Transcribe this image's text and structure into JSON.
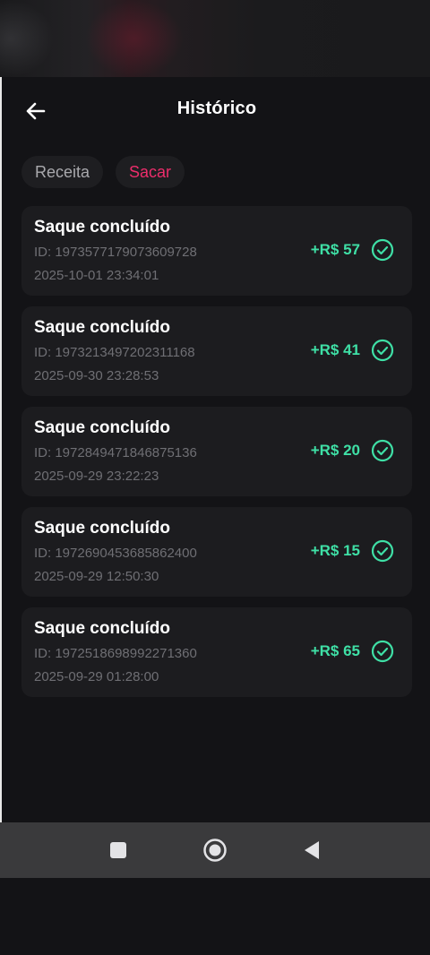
{
  "header": {
    "title": "Histórico",
    "back_icon": "arrow-left-icon"
  },
  "tabs": [
    {
      "label": "Receita",
      "active": false
    },
    {
      "label": "Sacar",
      "active": true
    }
  ],
  "transactions": [
    {
      "title": "Saque concluído",
      "id": "ID: 1973577179073609728",
      "date": "2025-10-01 23:34:01",
      "amount": "+R$ 57",
      "status_icon": "check-circle-icon"
    },
    {
      "title": "Saque concluído",
      "id": "ID: 1973213497202311168",
      "date": "2025-09-30 23:28:53",
      "amount": "+R$ 41",
      "status_icon": "check-circle-icon"
    },
    {
      "title": "Saque concluído",
      "id": "ID: 1972849471846875136",
      "date": "2025-09-29 23:22:23",
      "amount": "+R$ 20",
      "status_icon": "check-circle-icon"
    },
    {
      "title": "Saque concluído",
      "id": "ID: 1972690453685862400",
      "date": "2025-09-29 12:50:30",
      "amount": "+R$ 15",
      "status_icon": "check-circle-icon"
    },
    {
      "title": "Saque concluído",
      "id": "ID: 1972518698992271360",
      "date": "2025-09-29 01:28:00",
      "amount": "+R$ 65",
      "status_icon": "check-circle-icon"
    }
  ],
  "nav": {
    "recents_icon": "square-icon",
    "home_icon": "circle-home-icon",
    "back_icon": "triangle-back-icon"
  },
  "colors": {
    "accent": "#ec2d6b",
    "positive": "#3fe0a6",
    "background": "#131316",
    "card": "#1c1c1f"
  }
}
